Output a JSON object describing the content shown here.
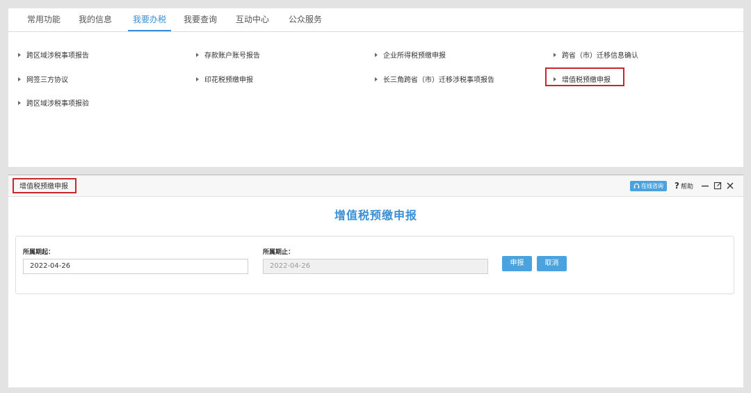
{
  "tabs": [
    {
      "label": "常用功能"
    },
    {
      "label": "我的信息"
    },
    {
      "label": "我要办税",
      "active": true
    },
    {
      "label": "我要查询"
    },
    {
      "label": "互动中心"
    },
    {
      "label": "公众服务"
    }
  ],
  "menu": {
    "items": [
      {
        "label": "跨区域涉税事项报告"
      },
      {
        "label": "存款账户账号报告"
      },
      {
        "label": "企业所得税预缴申报"
      },
      {
        "label": "跨省（市）迁移信息确认"
      },
      {
        "label": "网签三方协议"
      },
      {
        "label": "印花税预缴申报"
      },
      {
        "label": "长三角跨省（市）迁移涉税事项报告"
      },
      {
        "label": "增值税预缴申报",
        "highlighted": true
      },
      {
        "label": "跨区域涉税事项报验"
      }
    ]
  },
  "window": {
    "title": "增值税预缴申报",
    "consult_label": "在线咨询",
    "help_label": "帮助",
    "heading": "增值税预缴申报",
    "form": {
      "start_label": "所属期起：",
      "start_value": "2022-04-26",
      "end_label": "所属期止：",
      "end_value": "2022-04-26",
      "submit_label": "申报",
      "cancel_label": "取消"
    }
  },
  "colors": {
    "accent": "#3a8fd6",
    "button": "#4aa3df",
    "highlight": "#c8262b"
  }
}
